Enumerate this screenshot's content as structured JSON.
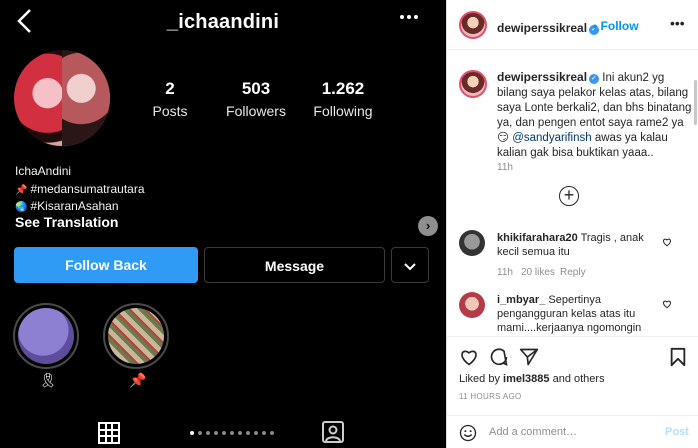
{
  "profile": {
    "username": "_ichaandini",
    "stats": [
      {
        "value": "2",
        "label": "Posts"
      },
      {
        "value": "503",
        "label": "Followers"
      },
      {
        "value": "1.262",
        "label": "Following"
      }
    ],
    "name": "IchaAndini",
    "bio_line1": "#medansumatrautara",
    "bio_line2": "#KisaranAsahan",
    "see_translation": "See Translation",
    "follow_back": "Follow Back",
    "message": "Message",
    "highlights": [
      {
        "label": "🎗"
      },
      {
        "label": "📌"
      }
    ]
  },
  "post": {
    "author": "dewiperssikreal",
    "follow": "Follow",
    "caption_user": "dewiperssikreal",
    "caption_text": "Ini akun2 yg bilang saya pelakor kelas atas, bilang saya Lonte berkali2, dan bhs binatang ya, dan pengen entot saya rame2 ya 😏",
    "caption_mention": "@sandyarifinsh",
    "caption_tail": "awas ya kalau kalian gak bisa buktikan yaaa..",
    "caption_time": "11h",
    "comments": [
      {
        "user": "khikifarahara20",
        "text": "Tragis , anak kecil semua itu",
        "time": "11h",
        "likes": "20 likes",
        "reply": "Reply"
      },
      {
        "user": "i_mbyar_",
        "text": "Sepertinya pengangguran kelas atas itu mami....kerjaanya ngomongin"
      }
    ],
    "liked_by_prefix": "Liked by",
    "liked_by_user": "imel3885",
    "liked_by_suffix": "and others",
    "post_time": "11 HOURS AGO",
    "add_comment_placeholder": "Add a comment…",
    "post_button": "Post"
  }
}
